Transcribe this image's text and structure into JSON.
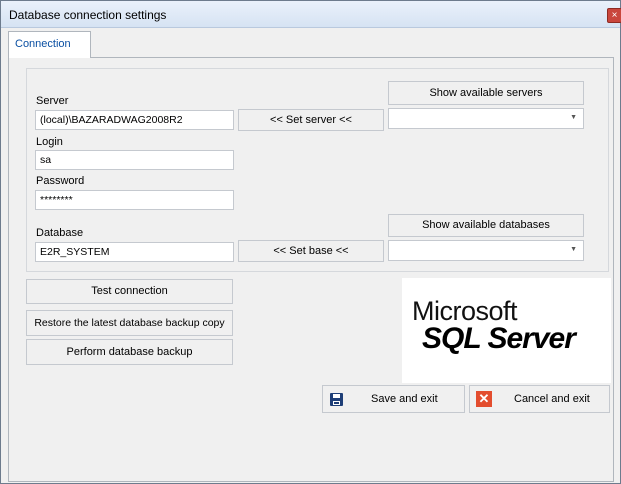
{
  "window": {
    "title": "Database connection settings",
    "close_glyph": "×"
  },
  "tabs": [
    {
      "label": "Connection",
      "active": true
    }
  ],
  "server": {
    "label": "Server",
    "value": "(local)\\BAZARADWAG2008R2",
    "set_button": "<< Set server <<",
    "show_button": "Show available servers",
    "dropdown_value": ""
  },
  "login": {
    "label": "Login",
    "value": "sa"
  },
  "password": {
    "label": "Password",
    "value": "********"
  },
  "database": {
    "label": "Database",
    "value": "E2R_SYSTEM",
    "set_button": "<< Set base <<",
    "show_button": "Show available databases",
    "dropdown_value": ""
  },
  "actions": {
    "test": "Test connection",
    "restore": "Restore the latest database backup copy",
    "backup": "Perform database backup"
  },
  "logo": {
    "line1": "Microsoft",
    "line2": "SQL Server"
  },
  "footer": {
    "save": "Save and exit",
    "cancel": "Cancel and exit"
  },
  "icons": {
    "save": "floppy-disk-icon",
    "cancel": "red-x-icon",
    "dropdown": "chevron-down-icon"
  }
}
